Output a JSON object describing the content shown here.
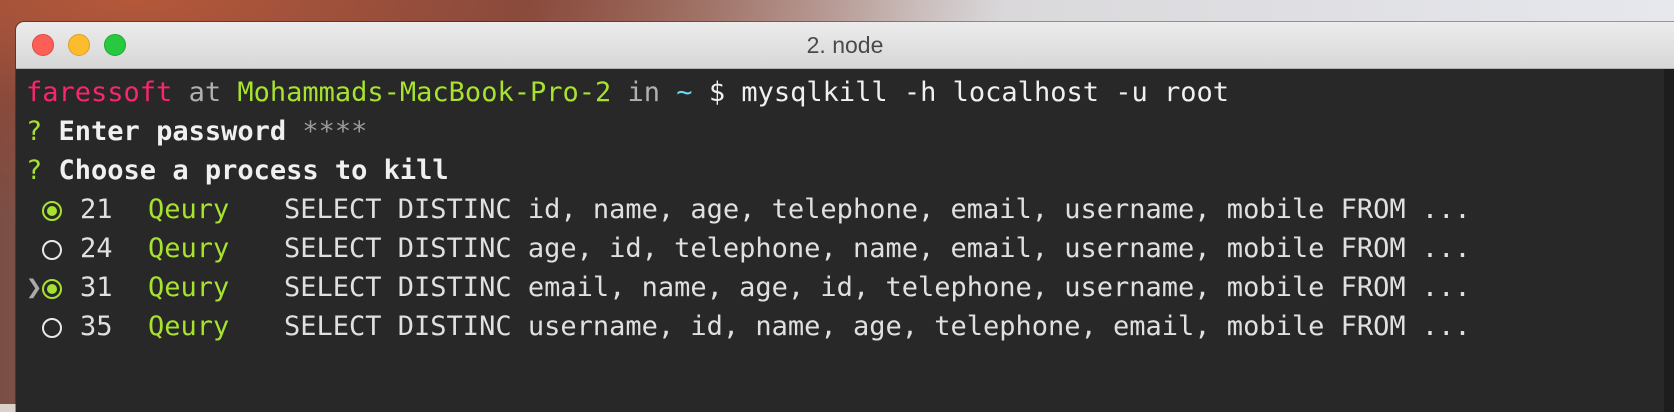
{
  "window": {
    "title": "2. node"
  },
  "prompt": {
    "user": "faressoft",
    "at": "at",
    "host": "Mohammads-MacBook-Pro-2",
    "in": "in",
    "dir": "~",
    "symbol": "$",
    "command": "mysqlkill -h localhost -u root"
  },
  "questions": [
    {
      "mark": "?",
      "text": "Enter password",
      "answer": "****"
    },
    {
      "mark": "?",
      "text": "Choose a process to kill",
      "answer": ""
    }
  ],
  "processes": [
    {
      "id": "21",
      "type": "Qeury",
      "query": "SELECT DISTINC id, name, age, telephone, email, username, mobile FROM ...",
      "checked": true,
      "cursor": false
    },
    {
      "id": "24",
      "type": "Qeury",
      "query": "SELECT DISTINC age, id, telephone, name, email, username, mobile FROM ...",
      "checked": false,
      "cursor": false
    },
    {
      "id": "31",
      "type": "Qeury",
      "query": "SELECT DISTINC email, name, age, id, telephone, username, mobile FROM ...",
      "checked": true,
      "cursor": true
    },
    {
      "id": "35",
      "type": "Qeury",
      "query": "SELECT DISTINC username, id, name, age, telephone, email, mobile FROM ...",
      "checked": false,
      "cursor": false
    }
  ],
  "cursor_glyph": "❯",
  "colors": {
    "user": "#f9266e",
    "host": "#a6e22e",
    "dir": "#66d9ef",
    "question_mark": "#a6e22e",
    "process_type": "#a6e22e",
    "selected_radio": "#a6e22e",
    "terminal_bg": "#282828"
  },
  "icons": {
    "close": "close-traffic-light-icon",
    "minimize": "minimize-traffic-light-icon",
    "maximize": "maximize-traffic-light-icon",
    "radio_on": "radio-checked-icon",
    "radio_off": "radio-unchecked-icon",
    "pointer": "pointer-caret-icon"
  }
}
